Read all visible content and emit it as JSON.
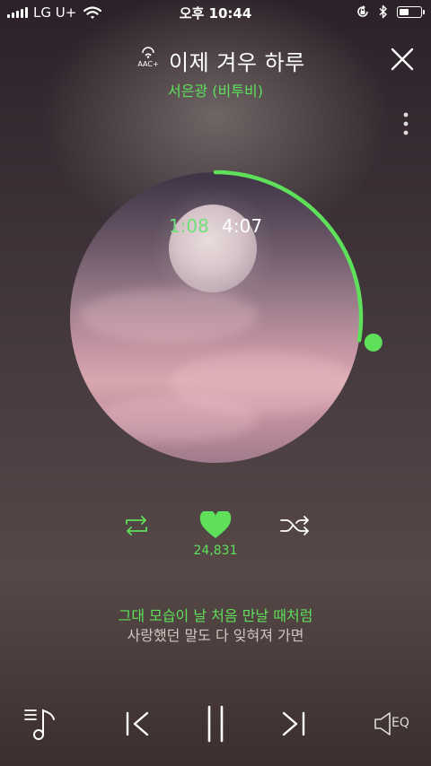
{
  "status_bar": {
    "carrier": "LG U+",
    "time": "오후 10:44"
  },
  "header": {
    "codec_label": "AAC+",
    "title": "이제 겨우 하루",
    "artist": "서은광 (비투비)"
  },
  "player": {
    "elapsed": "1:08",
    "separator": "·",
    "total": "4:07",
    "progress": 0.275,
    "like_count": "24,831"
  },
  "lyrics": {
    "current": "그대 모습이 날 처음 만날 때처럼",
    "next": "사랑했던 말도 다 잊혀져 가면"
  },
  "controls": {
    "eq_label": "EQ"
  },
  "colors": {
    "accent": "#5ee05a",
    "background_top": "#2b2128",
    "background_bottom": "#3b2f2e"
  },
  "icons": [
    "signal-icon",
    "wifi-icon",
    "orientation-lock-icon",
    "bluetooth-icon",
    "battery-icon",
    "aac-icon",
    "close-icon",
    "more-icon",
    "repeat-icon",
    "heart-icon",
    "shuffle-icon",
    "playlist-icon",
    "previous-icon",
    "pause-icon",
    "next-icon",
    "equalizer-icon"
  ]
}
